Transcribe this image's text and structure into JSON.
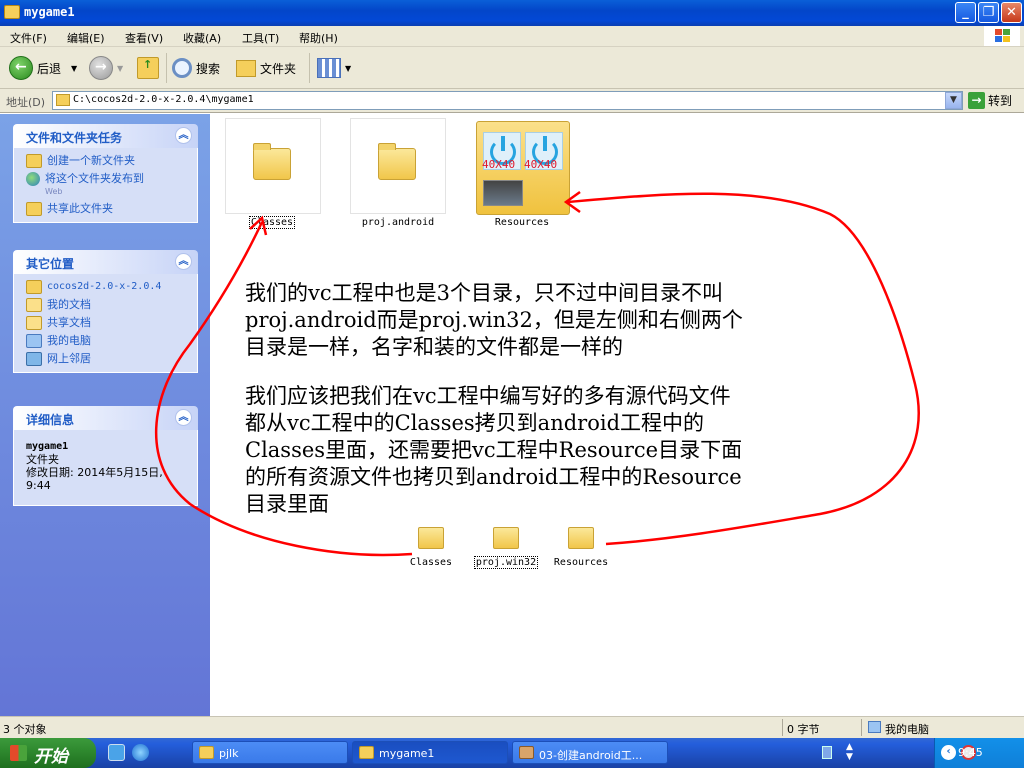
{
  "window": {
    "title": "mygame1"
  },
  "menu": [
    "文件(F)",
    "编辑(E)",
    "查看(V)",
    "收藏(A)",
    "工具(T)",
    "帮助(H)"
  ],
  "toolbar": {
    "back": "后退",
    "search": "搜索",
    "folders": "文件夹"
  },
  "address": {
    "label": "地址(D)",
    "path": "C:\\cocos2d-2.0-x-2.0.4\\mygame1",
    "go": "转到"
  },
  "panels": {
    "tasks": {
      "title": "文件和文件夹任务",
      "items": [
        "创建一个新文件夹",
        "将这个文件夹发布到",
        "Web",
        "共享此文件夹"
      ]
    },
    "places": {
      "title": "其它位置",
      "items": [
        "cocos2d-2.0-x-2.0.4",
        "我的文档",
        "共享文档",
        "我的电脑",
        "网上邻居"
      ]
    },
    "details": {
      "title": "详细信息",
      "name": "mygame1",
      "type": "文件夹",
      "modified": "修改日期: 2014年5月15日,",
      "time": "9:44"
    }
  },
  "folders": [
    "Classes",
    "proj.android",
    "Resources"
  ],
  "resources_thumb_labels": [
    "40X40",
    "40X40"
  ],
  "note": {
    "para1": [
      "我们的vc工程中也是3个目录，只不过中间目录不叫",
      "proj.android而是proj.win32，但是左侧和右侧两个",
      "目录是一样，名字和装的文件都是一样的"
    ],
    "para2": [
      "我们应该把我们在vc工程中编写好的多有源代码文件",
      "都从vc工程中的Classes拷贝到android工程中的",
      "Classes里面，还需要把vc工程中Resource目录下面",
      "的所有资源文件也拷贝到android工程中的Resource",
      "目录里面"
    ]
  },
  "small_folders": [
    "Classes",
    "proj.win32",
    "Resources"
  ],
  "status": {
    "objects": "3 个对象",
    "size": "0 字节",
    "location": "我的电脑"
  },
  "taskbar": {
    "start": "开始",
    "tasks": [
      "pjlk",
      "mygame1",
      "03-创建android工..."
    ],
    "clock": "9:45"
  },
  "colors": {
    "title_blue": "#0348d6",
    "annotation_red": "#ff0000",
    "link_blue": "#215dc6"
  }
}
